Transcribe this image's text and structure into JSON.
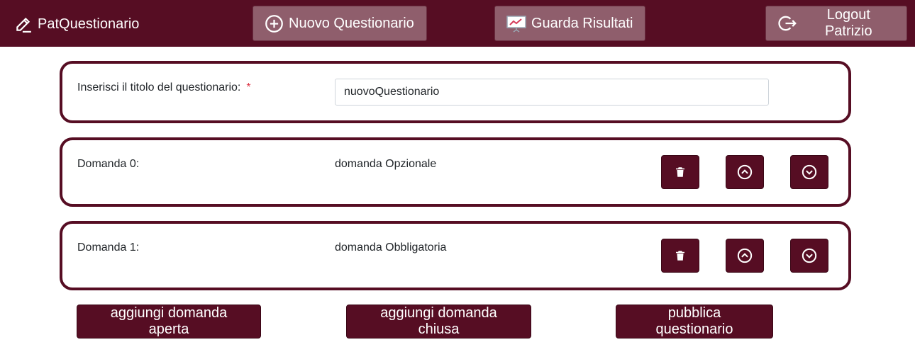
{
  "navbar": {
    "brand": "PatQuestionario",
    "brand_icon": "pencil-icon",
    "nuovo_label": "Nuovo Questionario",
    "nuovo_icon": "plus-circle-icon",
    "risultati_label": "Guarda Risultati",
    "risultati_icon": "chart-presentation-icon",
    "logout_label": "Logout Patrizio",
    "logout_icon": "logout-icon"
  },
  "form": {
    "title_label": "Inserisci il titolo del questionario:",
    "required_mark": "*",
    "title_value": "nuovoQuestionario"
  },
  "questions": [
    {
      "label": "Domanda 0:",
      "text": "domanda Opzionale"
    },
    {
      "label": "Domanda 1:",
      "text": "domanda Obbligatoria"
    }
  ],
  "actions": {
    "add_open": "aggiungi domanda aperta",
    "add_closed": "aggiungi domanda chiusa",
    "publish": "pubblica questionario"
  },
  "colors": {
    "brand": "#560d23",
    "nav_button": "#8f5e6c",
    "required": "#dc3545"
  }
}
